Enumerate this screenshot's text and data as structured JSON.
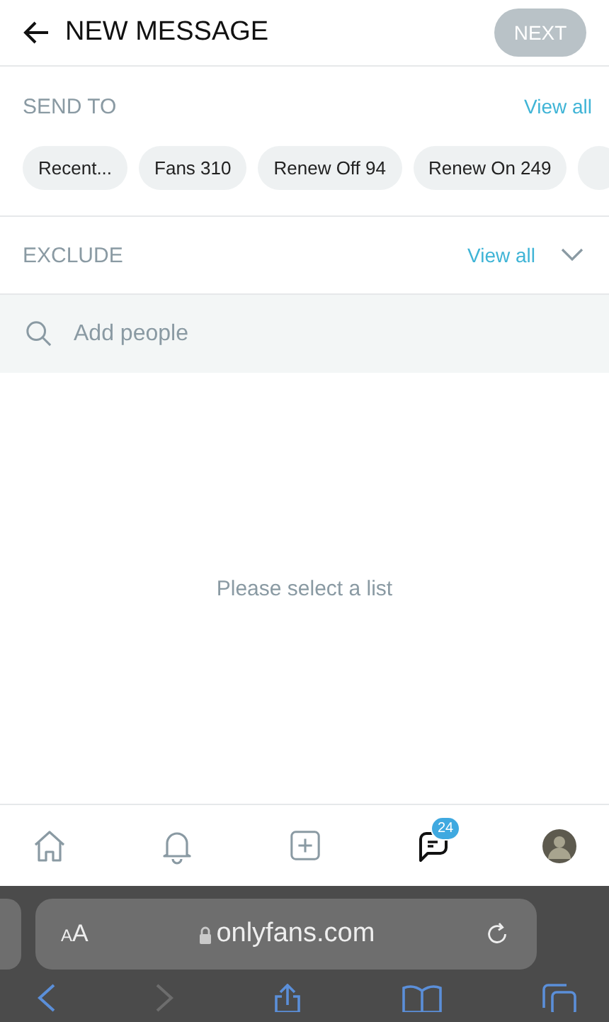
{
  "header": {
    "title": "NEW MESSAGE",
    "next_button": {
      "label": "NEXT",
      "disabled": true
    }
  },
  "send_to": {
    "label": "SEND TO",
    "view_all": "View all",
    "lists": [
      {
        "label": "Recent..."
      },
      {
        "label": "Fans 310"
      },
      {
        "label": "Renew Off 94"
      },
      {
        "label": "Renew On 249"
      }
    ]
  },
  "exclude": {
    "label": "EXCLUDE",
    "view_all": "View all",
    "expanded": false
  },
  "search": {
    "placeholder": "Add people"
  },
  "empty_message": "Please select a list",
  "nav": [
    {
      "kind": "home",
      "selected": false
    },
    {
      "kind": "bell",
      "selected": false
    },
    {
      "kind": "plus",
      "selected": false
    },
    {
      "kind": "messages",
      "selected": true,
      "badge": "24"
    },
    {
      "kind": "avatar",
      "selected": false
    }
  ],
  "browser": {
    "text_size": "AA",
    "url": "onlyfans.com",
    "forward_disabled": true
  }
}
